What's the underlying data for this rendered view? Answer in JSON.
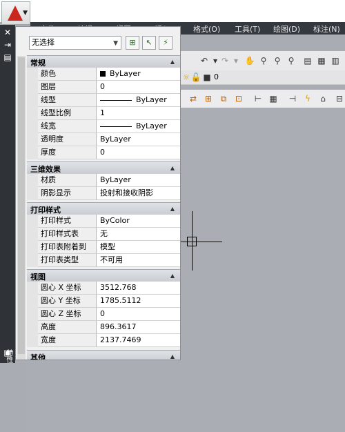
{
  "menubar": {
    "items": [
      "文件(F)",
      "编辑(E)",
      "视图(V)",
      "插入(I)",
      "格式(O)",
      "工具(T)",
      "绘图(D)",
      "标注(N)"
    ]
  },
  "toolbar2": {
    "layer_value": "0"
  },
  "left_strip": {
    "vertical_label": "特性"
  },
  "palette": {
    "selection": "无选择",
    "sections": {
      "general": {
        "title": "常规",
        "rows": [
          {
            "name": "颜色",
            "value": "ByLayer"
          },
          {
            "name": "图层",
            "value": "0"
          },
          {
            "name": "线型",
            "value": "ByLayer"
          },
          {
            "name": "线型比例",
            "value": "1"
          },
          {
            "name": "线宽",
            "value": "ByLayer"
          },
          {
            "name": "透明度",
            "value": "ByLayer"
          },
          {
            "name": "厚度",
            "value": "0"
          }
        ]
      },
      "effects3d": {
        "title": "三维效果",
        "rows": [
          {
            "name": "材质",
            "value": "ByLayer"
          },
          {
            "name": "阴影显示",
            "value": "投射和接收阴影"
          }
        ]
      },
      "plotstyle": {
        "title": "打印样式",
        "rows": [
          {
            "name": "打印样式",
            "value": "ByColor"
          },
          {
            "name": "打印样式表",
            "value": "无"
          },
          {
            "name": "打印表附着到",
            "value": "模型"
          },
          {
            "name": "打印表类型",
            "value": "不可用"
          }
        ]
      },
      "view": {
        "title": "视图",
        "rows": [
          {
            "name": "圆心 X 坐标",
            "value": "3512.768"
          },
          {
            "name": "圆心 Y 坐标",
            "value": "1785.5112"
          },
          {
            "name": "圆心 Z 坐标",
            "value": "0"
          },
          {
            "name": "高度",
            "value": "896.3617"
          },
          {
            "name": "宽度",
            "value": "2137.7469"
          }
        ]
      },
      "misc": {
        "title": "其他"
      }
    }
  },
  "colors": {
    "menubar": "#34383f",
    "canvas": "#aaadb3",
    "logo": "#c8281e"
  }
}
